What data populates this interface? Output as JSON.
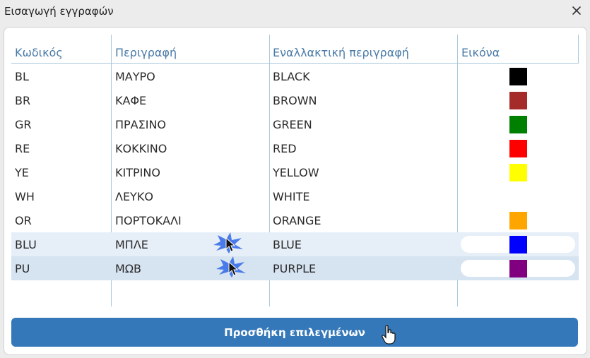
{
  "window": {
    "title": "Εισαγωγή εγγραφών"
  },
  "table": {
    "columns": [
      "Κωδικός",
      "Περιγραφή",
      "Εναλλακτική περιγραφή",
      "Εικόνα"
    ],
    "rows": [
      {
        "code": "BL",
        "desc": "ΜΑΥΡΟ",
        "alt": "BLACK",
        "color": "#000000"
      },
      {
        "code": "BR",
        "desc": "ΚΑΦΕ",
        "alt": "BROWN",
        "color": "#a52a2a"
      },
      {
        "code": "GR",
        "desc": "ΠΡΑΣΙΝΟ",
        "alt": "GREEN",
        "color": "#008000"
      },
      {
        "code": "RE",
        "desc": "ΚΟΚΚΙΝΟ",
        "alt": "RED",
        "color": "#ff0000"
      },
      {
        "code": "YE",
        "desc": "ΚΙΤΡΙΝΟ",
        "alt": "YELLOW",
        "color": "#ffff00"
      },
      {
        "code": "WH",
        "desc": "ΛΕΥΚΟ",
        "alt": "WHITE",
        "color": "#ffffff"
      },
      {
        "code": "OR",
        "desc": "ΠΟΡΤΟΚΑΛΙ",
        "alt": "ORANGE",
        "color": "#ffa500"
      },
      {
        "code": "BLU",
        "desc": "ΜΠΛΕ",
        "alt": "BLUE",
        "color": "#0000ff"
      },
      {
        "code": "PU",
        "desc": "ΜΩΒ",
        "alt": "PURPLE",
        "color": "#800080"
      }
    ]
  },
  "actions": {
    "add_selected_label": "Προσθήκη επιλεγμένων"
  },
  "colors": {
    "accent": "#3578b9",
    "header_text": "#4a7ba7",
    "grid_line": "#a9c8de",
    "selected_row_1": "#e6eef7",
    "selected_row_2": "#d6e3f1"
  }
}
